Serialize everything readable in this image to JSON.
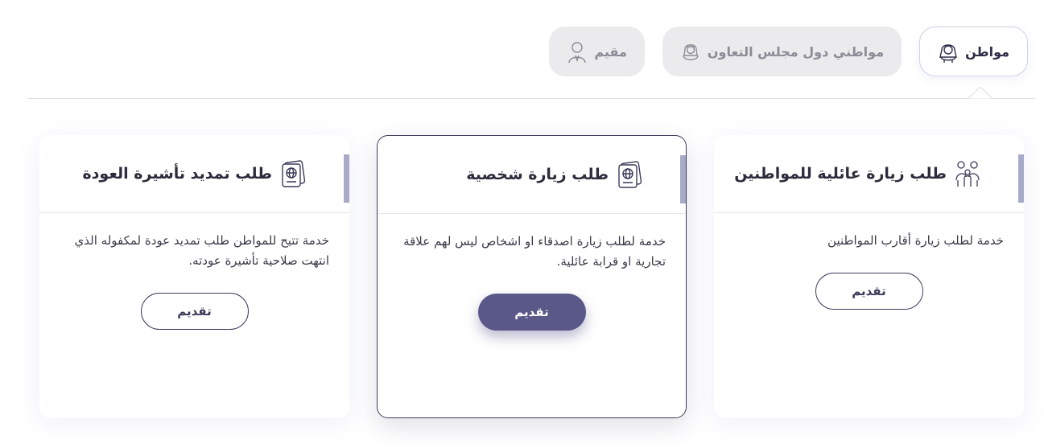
{
  "tabs": [
    {
      "label": "مواطن",
      "icon": "citizen-icon",
      "active": true
    },
    {
      "label": "مواطني دول مجلس التعاون",
      "icon": "gcc-citizen-icon",
      "active": false
    },
    {
      "label": "مقيم",
      "icon": "resident-icon",
      "active": false
    }
  ],
  "cards": [
    {
      "title": "طلب زيارة عائلية للمواطنين",
      "icon": "family-icon",
      "description": "خدمة لطلب زيارة أقارب المواطنين",
      "cta": "تقديم"
    },
    {
      "title": "طلب زيارة شخصية",
      "icon": "passport-icon",
      "description": "خدمة لطلب زيارة اصدقاء او اشخاص ليس لهم علاقة تجارية او قرابة عائلية.",
      "cta": "تقديم"
    },
    {
      "title": "طلب تمديد تأشيرة العودة",
      "icon": "passport-icon",
      "description": "خدمة تتيح للمواطن طلب تمديد عودة لمكفوله الذي انتهت صلاحية تأشيرة عودته.",
      "cta": "تقديم"
    }
  ],
  "colors": {
    "accent": "#5a5888",
    "accent_bar": "#a8aac8",
    "inactive_tab_bg": "#ebebed"
  }
}
